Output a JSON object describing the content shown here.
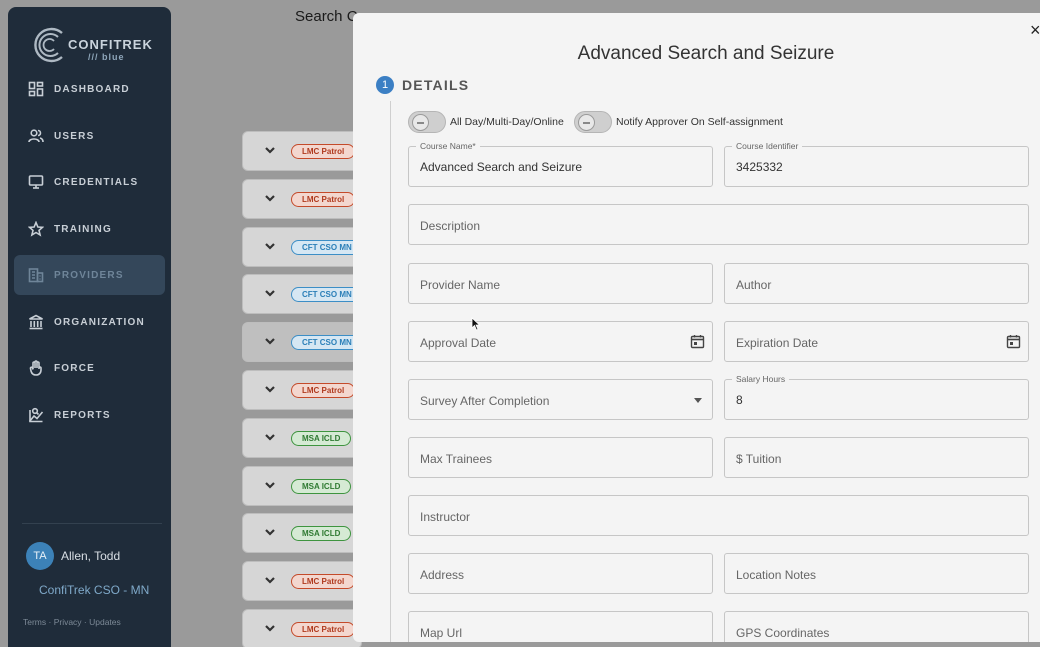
{
  "sidebar": {
    "logo": {
      "brand": "CONFITREK",
      "sub": "/// blue"
    },
    "items": [
      {
        "label": "DASHBOARD",
        "icon": "dashboard-icon"
      },
      {
        "label": "USERS",
        "icon": "users-icon"
      },
      {
        "label": "CREDENTIALS",
        "icon": "credentials-icon"
      },
      {
        "label": "TRAINING",
        "icon": "star-icon"
      },
      {
        "label": "PROVIDERS",
        "icon": "providers-icon",
        "active": true
      },
      {
        "label": "ORGANIZATION",
        "icon": "organization-icon"
      },
      {
        "label": "FORCE",
        "icon": "hand-icon"
      },
      {
        "label": "REPORTS",
        "icon": "reports-icon"
      }
    ],
    "user": {
      "initials": "TA",
      "name": "Allen, Todd",
      "org": "ConfiTrek CSO - MN"
    },
    "footer": "Terms · Privacy · Updates"
  },
  "background": {
    "title": "Search Co",
    "rows": [
      {
        "tag": "LMC Patrol",
        "color": "red"
      },
      {
        "tag": "LMC Patrol",
        "color": "red"
      },
      {
        "tag": "CFT CSO MN",
        "color": "blue"
      },
      {
        "tag": "CFT CSO MN",
        "color": "blue"
      },
      {
        "tag": "CFT CSO MN",
        "color": "blue"
      },
      {
        "tag": "LMC Patrol",
        "color": "red"
      },
      {
        "tag": "MSA ICLD",
        "color": "green"
      },
      {
        "tag": "MSA ICLD",
        "color": "green"
      },
      {
        "tag": "MSA ICLD",
        "color": "green"
      },
      {
        "tag": "LMC Patrol",
        "color": "red"
      },
      {
        "tag": "LMC Patrol",
        "color": "red"
      }
    ]
  },
  "modal": {
    "title": "Advanced Search and Seizure",
    "close": "×",
    "step_number": "1",
    "step_label": "DETAILS",
    "toggles": {
      "all_day": "All Day/Multi-Day/Online",
      "notify": "Notify Approver On Self-assignment"
    },
    "fields": {
      "course_name_label": "Course Name*",
      "course_name_value": "Advanced Search and Seizure",
      "course_id_label": "Course Identifier",
      "course_id_value": "3425332",
      "description": "Description",
      "provider_name": "Provider Name",
      "author": "Author",
      "approval_date": "Approval Date",
      "expiration_date": "Expiration Date",
      "survey": "Survey After Completion",
      "salary_label": "Salary Hours",
      "salary_value": "8",
      "max_trainees": "Max Trainees",
      "tuition": "$ Tuition",
      "instructor": "Instructor",
      "address": "Address",
      "location_notes": "Location Notes",
      "map_url": "Map Url",
      "gps": "GPS Coordinates"
    }
  }
}
